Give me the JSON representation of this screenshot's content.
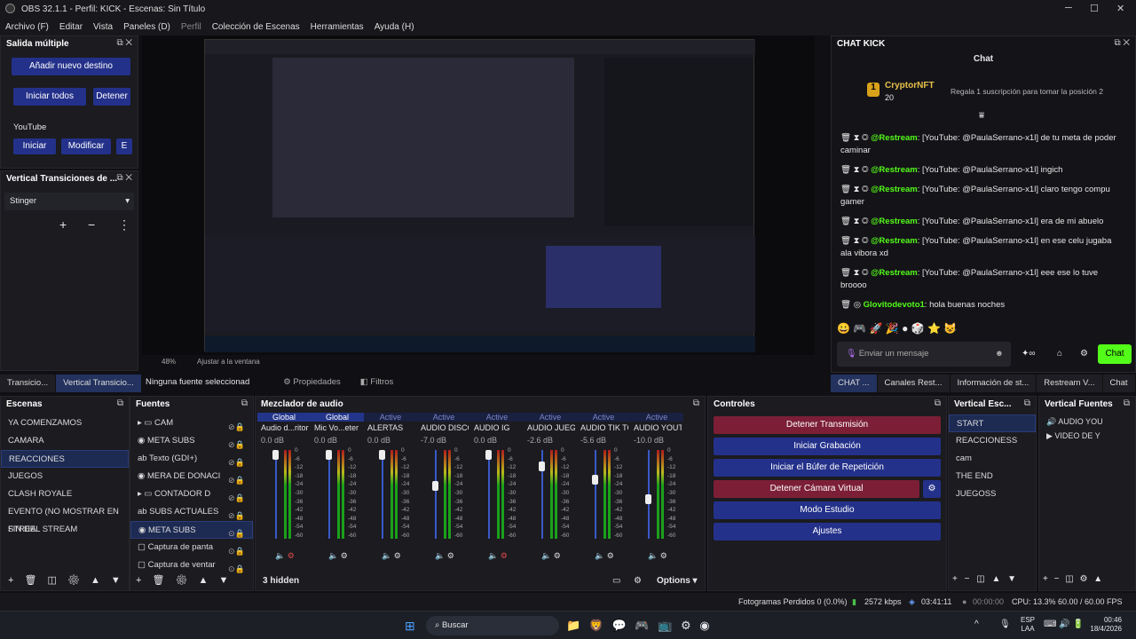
{
  "window": {
    "title": "OBS 32.1.1 - Perfil: KICK - Escenas: Sin Título"
  },
  "menu": [
    "Archivo (F)",
    "Editar",
    "Vista",
    "Paneles (D)",
    "Perfil",
    "Colección de Escenas",
    "Herramientas",
    "Ayuda (H)"
  ],
  "salida": {
    "title": "Salida múltiple",
    "add_label": "Añadir nuevo destino",
    "start_all": "Iniciar todos",
    "stop_all": "Detener",
    "service": "YouTube",
    "start": "Iniciar",
    "modify": "Modificar",
    "e": "E"
  },
  "vtrans": {
    "title": "Vertical Transiciones de ...",
    "value": "Stinger"
  },
  "preview": {
    "zoom": "48%",
    "fit": "Ajustar a la ventana"
  },
  "left_tabs": [
    "Transicio...",
    "Vertical Transicio..."
  ],
  "source_bar": {
    "none": "Ninguna fuente seleccionad",
    "props": "Propiedades",
    "filters": "Filtros"
  },
  "chat": {
    "panel_title": "CHAT KICK",
    "title": "Chat",
    "top_user": "CryptorNFT",
    "top_count": "20",
    "promo": "Regala 1 suscripción para tomar la posición 2",
    "messages": [
      {
        "user": "@Restream",
        "text": ": [YouTube: @PaulaSerrano-x1l] de tu meta de poder caminar"
      },
      {
        "user": "@Restream",
        "text": ": [YouTube: @PaulaSerrano-x1l] ingich"
      },
      {
        "user": "@Restream",
        "text": ": [YouTube: @PaulaSerrano-x1l] claro tengo compu gamer"
      },
      {
        "user": "@Restream",
        "text": ": [YouTube: @PaulaSerrano-x1l] era de mi abuelo"
      },
      {
        "user": "@Restream",
        "text": ": [YouTube: @PaulaSerrano-x1l] en ese celu jugaba ala vibora xd"
      },
      {
        "user": "@Restream",
        "text": ": [YouTube: @PaulaSerrano-x1l] eee ese lo tuve broooo"
      },
      {
        "user": "Glovitodevoto1",
        "text": ": hola buenas noches"
      }
    ],
    "placeholder": "Enviar un mensaje",
    "send": "Chat"
  },
  "right_tabs": [
    "CHAT ...",
    "Canales Rest...",
    "Información de st...",
    "Restream V...",
    "Chat"
  ],
  "escenas": {
    "title": "Escenas",
    "items": [
      "YA COMENZAMOS",
      "CAMARA",
      "REACCIONES",
      "JUEGOS",
      "CLASH ROYALE",
      "EVENTO (NO MOSTRAR EN STREA",
      "FIN DEL STREAM"
    ]
  },
  "fuentes": {
    "title": "Fuentes",
    "items": [
      "CAM",
      "META SUBS",
      "Texto (GDI+)",
      "MERA DE DONACI",
      "CONTADOR D",
      "SUBS ACTUALES",
      "META SUBS",
      "Captura de panta",
      "Captura de ventar"
    ]
  },
  "mixer": {
    "title": "Mezclador de audio",
    "hidden": "3 hidden",
    "options": "Options",
    "channels": [
      {
        "tag": "Global",
        "name": "Audio d...ritorio",
        "db": "0.0 dB"
      },
      {
        "tag": "Global",
        "name": "Mic Vo...eter",
        "db": "0.0 dB"
      },
      {
        "tag": "Active",
        "name": "ALERTAS",
        "db": "0.0 dB"
      },
      {
        "tag": "Active",
        "name": "AUDIO DISCORD",
        "db": "-7.0 dB"
      },
      {
        "tag": "Active",
        "name": "AUDIO IG",
        "db": "0.0 dB"
      },
      {
        "tag": "Active",
        "name": "AUDIO JUEGOS",
        "db": "-2.6 dB"
      },
      {
        "tag": "Active",
        "name": "AUDIO TIK TOK",
        "db": "-5.6 dB"
      },
      {
        "tag": "Active",
        "name": "AUDIO YOUTUI",
        "db": "-10.0 dB"
      }
    ],
    "scale": [
      "0",
      "-6",
      "-12",
      "-18",
      "-24",
      "-30",
      "-36",
      "-42",
      "-48",
      "-54",
      "-60"
    ]
  },
  "controles": {
    "title": "Controles",
    "stop_stream": "Detener Transmisión",
    "start_rec": "Iniciar Grabación",
    "replay": "Iniciar el Búfer de Repetición",
    "stop_vcam": "Detener Cámara Virtual",
    "studio": "Modo Estudio",
    "settings": "Ajustes"
  },
  "vesc": {
    "title": "Vertical Esc...",
    "items": [
      "START",
      "REACCIONESS",
      "cam",
      "THE END",
      "JUEGOSS"
    ]
  },
  "vfuentes": {
    "title": "Vertical Fuentes",
    "items": [
      "AUDIO YOU",
      "VIDEO DE Y"
    ]
  },
  "status": {
    "frames": "Fotogramas Perdidos 0 (0.0%)",
    "kbps": "2572 kbps",
    "time1": "03:41:11",
    "time2": "00:00:00",
    "cpu": "CPU: 13.3%",
    "fps": "60.00 / 60.00 FPS"
  },
  "taskbar": {
    "search": "Buscar",
    "lang": "ESP",
    "region": "LAA",
    "time": "00:46",
    "date": "18/4/2026"
  },
  "colors": {
    "accent": "#24318a",
    "red": "#7c1f36",
    "kick": "#53fc18"
  }
}
